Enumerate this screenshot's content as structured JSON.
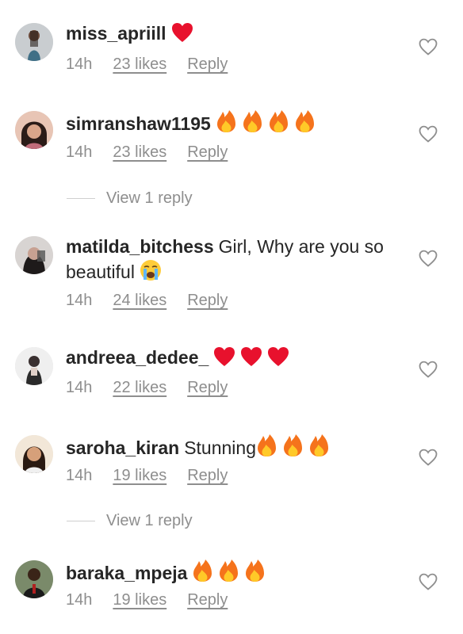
{
  "comments": [
    {
      "username": "miss_apriill",
      "text": "",
      "emojis": [
        "red-heart-emoji"
      ],
      "time": "14h",
      "likes": "23 likes",
      "reply": "Reply"
    },
    {
      "username": "simranshaw1195",
      "text": "",
      "emojis": [
        "fire-emoji",
        "fire-emoji",
        "fire-emoji",
        "fire-emoji"
      ],
      "time": "14h",
      "likes": "23 likes",
      "reply": "Reply"
    },
    {
      "username": "matilda_bitchess",
      "text": "Girl, Why are you so beautiful",
      "emojis": [
        "crying-face-emoji"
      ],
      "time": "14h",
      "likes": "24 likes",
      "reply": "Reply"
    },
    {
      "username": "andreea_dedee_",
      "text": "",
      "emojis": [
        "red-heart-emoji",
        "red-heart-emoji",
        "red-heart-emoji"
      ],
      "time": "14h",
      "likes": "22 likes",
      "reply": "Reply"
    },
    {
      "username": "saroha_kiran",
      "text": "Stunning",
      "emojis": [
        "fire-emoji",
        "fire-emoji",
        "fire-emoji"
      ],
      "time": "14h",
      "likes": "19 likes",
      "reply": "Reply"
    },
    {
      "username": "baraka_mpeja",
      "text": "",
      "emojis": [
        "fire-emoji",
        "fire-emoji",
        "fire-emoji"
      ],
      "time": "14h",
      "likes": "19 likes",
      "reply": "Reply"
    }
  ],
  "view_replies": [
    "View 1 reply",
    "View 1 reply"
  ],
  "like_icon": "heart-outline-icon",
  "colors": {
    "text": "#262626",
    "secondary": "#8e8e8e",
    "heart": "#e8112d",
    "fire": "#f5731c"
  }
}
